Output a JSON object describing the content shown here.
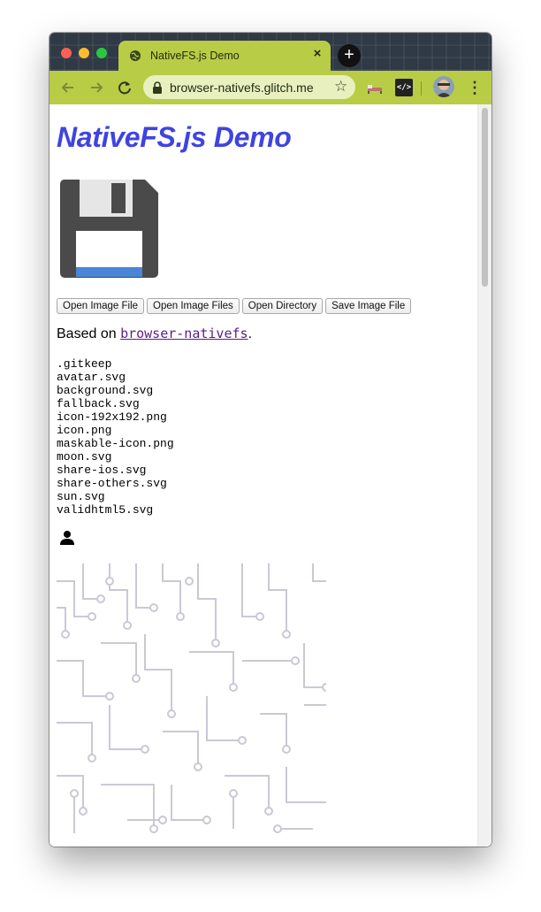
{
  "browser": {
    "tab_title": "NativeFS.js Demo",
    "tab_close": "×",
    "new_tab": "+",
    "url": "browser-nativefs.glitch.me",
    "menu": "⋮",
    "extension_code": "</>",
    "colors": {
      "toolbar": "#b9cc46",
      "tabstrip": "#2f3a46"
    }
  },
  "page": {
    "heading": "NativeFS.js Demo",
    "buttons": [
      "Open Image File",
      "Open Image Files",
      "Open Directory",
      "Save Image File"
    ],
    "based_on_prefix": "Based on ",
    "based_on_link": "browser-nativefs",
    "based_on_suffix": ".",
    "files": [
      ".gitkeep",
      "avatar.svg",
      "background.svg",
      "fallback.svg",
      "icon-192x192.png",
      "icon.png",
      "maskable-icon.png",
      "moon.svg",
      "share-ios.svg",
      "share-others.svg",
      "sun.svg",
      "validhtml5.svg"
    ],
    "icons": [
      "floppy-disk-icon",
      "person-icon",
      "circuit-background-image"
    ],
    "colors": {
      "heading": "#3f44e0",
      "link": "#5a1e8a"
    }
  }
}
